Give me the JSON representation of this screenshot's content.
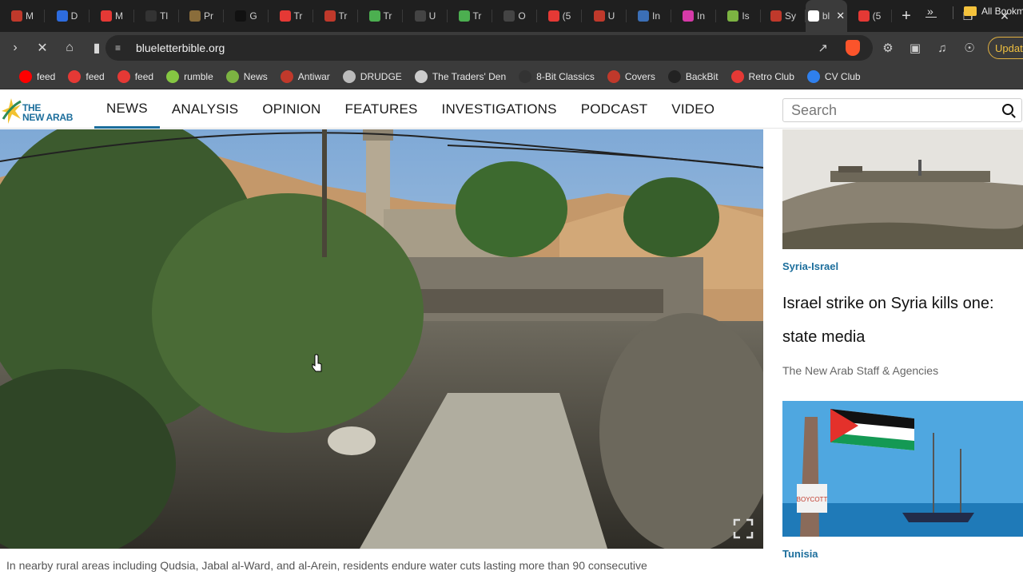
{
  "browser": {
    "tabs": [
      {
        "label": "M",
        "color": "#c0392b"
      },
      {
        "label": "D",
        "color": "#2d6cdf"
      },
      {
        "label": "M",
        "color": "#e53935"
      },
      {
        "label": "Tl",
        "color": "#333333"
      },
      {
        "label": "Pr",
        "color": "#8a6d3b"
      },
      {
        "label": "G",
        "color": "#111111"
      },
      {
        "label": "Tr",
        "color": "#e53935"
      },
      {
        "label": "Tr",
        "color": "#c0392b"
      },
      {
        "label": "Tr",
        "color": "#4caf50"
      },
      {
        "label": "U",
        "color": "#444444"
      },
      {
        "label": "Tr",
        "color": "#4caf50"
      },
      {
        "label": "O",
        "color": "#444444"
      },
      {
        "label": "(5",
        "color": "#e53935"
      },
      {
        "label": "U",
        "color": "#c0392b"
      },
      {
        "label": "In",
        "color": "#3b6fb6"
      },
      {
        "label": "In",
        "color": "#d63aa8"
      },
      {
        "label": "Is",
        "color": "#7cb342"
      },
      {
        "label": "Sy",
        "color": "#c0392b"
      },
      {
        "label": "bl",
        "color": "#ffffff",
        "active": true
      },
      {
        "label": "(5",
        "color": "#e53935"
      }
    ],
    "url": "blueletterbible.org",
    "update_label": "Update",
    "bookmarks": [
      {
        "label": "feed",
        "color": "#ff0000"
      },
      {
        "label": "feed",
        "color": "#e53935"
      },
      {
        "label": "feed",
        "color": "#e53935"
      },
      {
        "label": "rumble",
        "color": "#85c742"
      },
      {
        "label": "News",
        "color": "#7cb342"
      },
      {
        "label": "Antiwar",
        "color": "#c0392b"
      },
      {
        "label": "DRUDGE",
        "color": "#bbbbbb"
      },
      {
        "label": "The Traders' Den",
        "color": "#cccccc"
      },
      {
        "label": "8-Bit Classics",
        "color": "#333333"
      },
      {
        "label": "Covers",
        "color": "#c0392b"
      },
      {
        "label": "BackBit",
        "color": "#222222"
      },
      {
        "label": "Retro Club",
        "color": "#e53935"
      },
      {
        "label": "CV Club",
        "color": "#2f80ed"
      }
    ],
    "all_bookmarks_label": "All Bookmarks"
  },
  "site": {
    "logo_line1": "THE",
    "logo_line2": "NEW ARAB",
    "nav": [
      "NEWS",
      "ANALYSIS",
      "OPINION",
      "FEATURES",
      "INVESTIGATIONS",
      "PODCAST",
      "VIDEO"
    ],
    "active_nav": "NEWS",
    "search_placeholder": "Search",
    "hero_caption": "In nearby rural areas including Qudsia, Jabal al-Ward, and al-Arein, residents endure water cuts lasting more than 90 consecutive",
    "sidebar": {
      "card1": {
        "tag": "Syria-Israel",
        "headline_line1": "Israel strike on Syria kills one:",
        "headline_line2": "state media",
        "byline": "The New Arab Staff & Agencies"
      },
      "card2": {
        "tag": "Tunisia",
        "sign_text": "BOYCOTT"
      }
    }
  }
}
